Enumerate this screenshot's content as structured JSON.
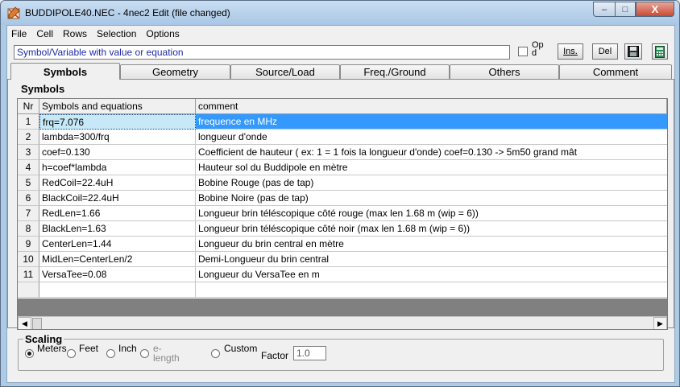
{
  "window": {
    "title": "BUDDIPOLE40.NEC - 4nec2 Edit (file changed)",
    "buttons": {
      "minimize": "–",
      "maximize": "□",
      "close": "X"
    }
  },
  "menu": {
    "file": "File",
    "cell": "Cell",
    "rows": "Rows",
    "selection": "Selection",
    "options": "Options"
  },
  "toolbar": {
    "edit_line": "Symbol/Variable with value or equation",
    "option_label": "Op d",
    "ins_label": "Ins.",
    "del_label": "Del"
  },
  "tabs": [
    "Symbols",
    "Geometry",
    "Source/Load",
    "Freq./Ground",
    "Others",
    "Comment"
  ],
  "panel_title": "Symbols",
  "table": {
    "headers": {
      "nr": "Nr",
      "symbol": "Symbols and equations",
      "comment": "comment"
    },
    "rows": [
      {
        "nr": "1",
        "symbol": "frq=7.076",
        "comment": "frequence en MHz"
      },
      {
        "nr": "2",
        "symbol": "lambda=300/frq",
        "comment": "longueur d'onde"
      },
      {
        "nr": "3",
        "symbol": "coef=0.130",
        "comment": "Coefficient de hauteur ( ex: 1 = 1 fois la longueur d'onde) coef=0.130 -> 5m50 grand mât"
      },
      {
        "nr": "4",
        "symbol": "h=coef*lambda",
        "comment": "Hauteur sol du Buddipole en mètre"
      },
      {
        "nr": "5",
        "symbol": "RedCoil=22.4uH",
        "comment": "Bobine Rouge (pas de tap)"
      },
      {
        "nr": "6",
        "symbol": "BlackCoil=22.4uH",
        "comment": "Bobine Noire (pas de tap)"
      },
      {
        "nr": "7",
        "symbol": "RedLen=1.66",
        "comment": "Longueur brin téléscopique côté rouge (max len 1.68 m (wip = 6))"
      },
      {
        "nr": "8",
        "symbol": "BlackLen=1.63",
        "comment": "Longueur brin téléscopique côté noir (max len 1.68 m (wip = 6))"
      },
      {
        "nr": "9",
        "symbol": "CenterLen=1.44",
        "comment": "Longueur du brin central en mètre"
      },
      {
        "nr": "10",
        "symbol": "MidLen=CenterLen/2",
        "comment": "Demi-Longueur du brin central"
      },
      {
        "nr": "11",
        "symbol": "VersaTee=0.08",
        "comment": "Longueur du VersaTee en m"
      },
      {
        "nr": "",
        "symbol": "",
        "comment": ""
      }
    ]
  },
  "scrollbar": {
    "left_arrow": "◀",
    "right_arrow": "▶"
  },
  "scaling": {
    "title": "Scaling",
    "options": [
      {
        "label": "Meters",
        "checked": true,
        "disabled": false
      },
      {
        "label": "Feet",
        "checked": false,
        "disabled": false
      },
      {
        "label": "Inch",
        "checked": false,
        "disabled": false
      },
      {
        "label": "e-length",
        "checked": false,
        "disabled": true
      },
      {
        "label": "Custom",
        "checked": false,
        "disabled": false
      }
    ],
    "factor_label": "Factor",
    "factor_value": "1.0"
  }
}
